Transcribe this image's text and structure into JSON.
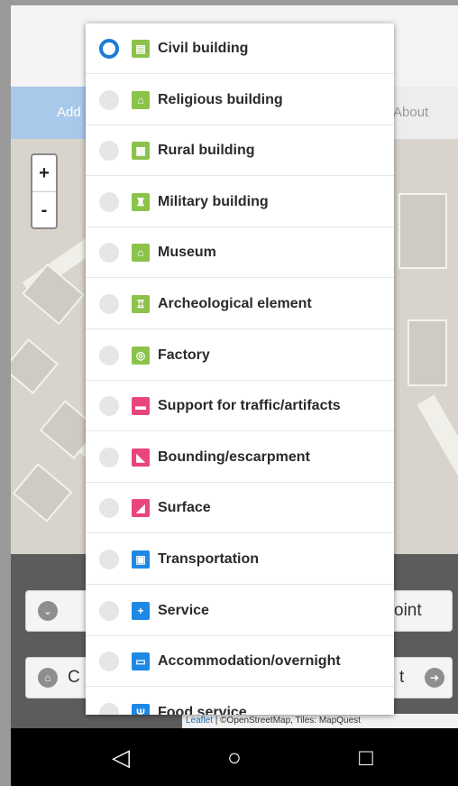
{
  "tabs": {
    "add_label": "Add",
    "about_label": "About"
  },
  "map": {
    "zoom_in": "+",
    "zoom_out": "-",
    "attribution_leaflet": "Leaflet",
    "attribution_rest": " | ©OpenStreetMap, Tiles: MapQuest"
  },
  "panel": {
    "right_button_1": "oint",
    "left_button_2": "C",
    "right_button_2": "t"
  },
  "navbar": {
    "back": "◁",
    "home": "○",
    "recent": "□"
  },
  "menu": {
    "selected_index": 0,
    "options": [
      {
        "label": "Civil building",
        "icon": "civil-building-icon",
        "color": "#8bc34a",
        "glyph": "▤"
      },
      {
        "label": "Religious building",
        "icon": "religious-building-icon",
        "color": "#8bc34a",
        "glyph": "⌂"
      },
      {
        "label": "Rural building",
        "icon": "rural-building-icon",
        "color": "#8bc34a",
        "glyph": "▦"
      },
      {
        "label": "Military building",
        "icon": "military-building-icon",
        "color": "#8bc34a",
        "glyph": "♜"
      },
      {
        "label": "Museum",
        "icon": "museum-icon",
        "color": "#8bc34a",
        "glyph": "⌂"
      },
      {
        "label": "Archeological element",
        "icon": "archeological-element-icon",
        "color": "#8bc34a",
        "glyph": "♖"
      },
      {
        "label": "Factory",
        "icon": "factory-icon",
        "color": "#8bc34a",
        "glyph": "◎"
      },
      {
        "label": "Support for traffic/artifacts",
        "icon": "traffic-support-icon",
        "color": "#e8457f",
        "glyph": "▬"
      },
      {
        "label": "Bounding/escarpment",
        "icon": "bounding-escarpment-icon",
        "color": "#e8457f",
        "glyph": "◣"
      },
      {
        "label": "Surface",
        "icon": "surface-icon",
        "color": "#e8457f",
        "glyph": "◢"
      },
      {
        "label": "Transportation",
        "icon": "transportation-icon",
        "color": "#1e88e5",
        "glyph": "▣"
      },
      {
        "label": "Service",
        "icon": "service-icon",
        "color": "#1e88e5",
        "glyph": "+"
      },
      {
        "label": "Accommodation/overnight",
        "icon": "accommodation-icon",
        "color": "#1e88e5",
        "glyph": "▭"
      },
      {
        "label": "Food service",
        "icon": "food-service-icon",
        "color": "#1e88e5",
        "glyph": "Ψ"
      }
    ]
  }
}
